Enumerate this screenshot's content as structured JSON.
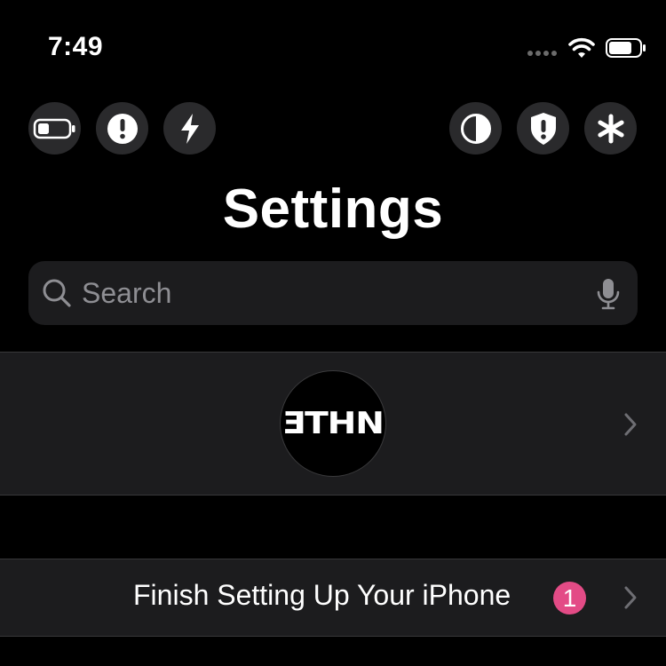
{
  "status_bar": {
    "time": "7:49",
    "icons": [
      "signal-dots",
      "wifi-icon",
      "battery-icon"
    ]
  },
  "quick_actions": [
    {
      "icon": "battery-low-icon"
    },
    {
      "icon": "exclamation-icon"
    },
    {
      "icon": "bolt-icon"
    },
    {
      "icon": "contrast-icon"
    },
    {
      "icon": "shield-alert-icon"
    },
    {
      "icon": "asterisk-icon"
    }
  ],
  "header": {
    "title": "Settings"
  },
  "search": {
    "placeholder": "Search",
    "value": ""
  },
  "profile": {
    "avatar_text": "ƎTHN"
  },
  "setup": {
    "label": "Finish Setting Up Your iPhone",
    "badge_count": "1"
  },
  "colors": {
    "background": "#000000",
    "cell": "#1c1c1e",
    "quick_button": "#2a2a2c",
    "badge": "#e34b86",
    "secondary_text": "#8e8e93"
  }
}
